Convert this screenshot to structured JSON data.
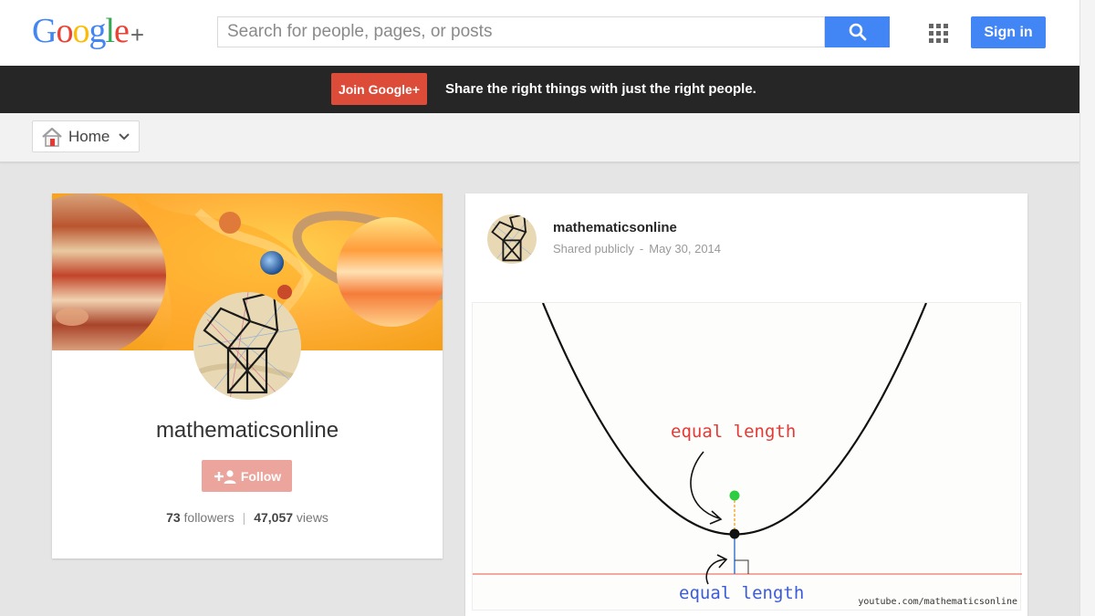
{
  "header": {
    "logo_text": "Google",
    "logo_plus": "+",
    "search_placeholder": "Search for people, pages, or posts",
    "signin_label": "Sign in"
  },
  "promo": {
    "join_label": "Join Google+",
    "tagline": "Share the right things with just the right people."
  },
  "nav": {
    "home_label": "Home"
  },
  "profile": {
    "name": "mathematicsonline",
    "follow_label": "Follow",
    "followers_count": "73",
    "followers_label": "followers",
    "separator": "|",
    "views_count": "47,057",
    "views_label": "views"
  },
  "post": {
    "author": "mathematicsonline",
    "visibility": "Shared publicly",
    "separator": "-",
    "date": "May 30, 2014",
    "media": {
      "label_top": "equal length",
      "label_bottom": "equal length",
      "watermark": "youtube.com/mathematicsonline"
    }
  },
  "colors": {
    "brand_blue": "#4285f4",
    "join_red": "#dd4b39",
    "follow_disabled": "#eba59d",
    "promo_bg": "#262626"
  }
}
